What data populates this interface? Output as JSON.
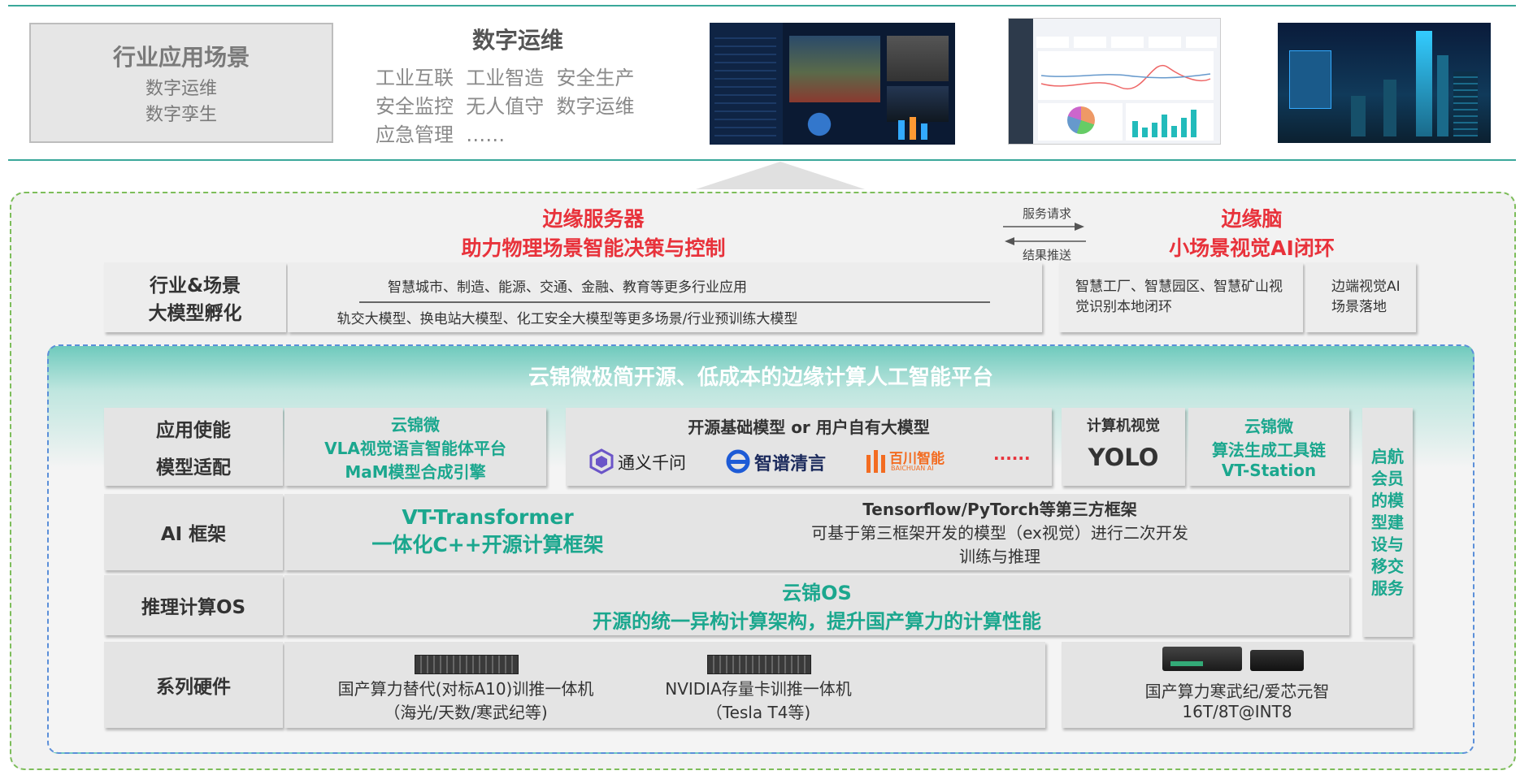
{
  "top": {
    "industry_box": {
      "title": "行业应用场景",
      "line1": "数字运维",
      "line2": "数字孪生"
    },
    "ops": {
      "title": "数字运维",
      "rows": [
        "工业互联  工业智造  安全生产",
        "安全监控  无人值守  数字运维",
        "应急管理  ……"
      ]
    }
  },
  "edge_server": {
    "line1": "边缘服务器",
    "line2": "助力物理场景智能决策与控制"
  },
  "arrows": {
    "request": "服务请求",
    "push": "结果推送"
  },
  "edge_brain": {
    "line1": "边缘脑",
    "line2": "小场景视觉AI闭环"
  },
  "incubation": {
    "label_1": "行业&场景",
    "label_2": "大模型孵化",
    "row1": "智慧城市、制造、能源、交通、金融、教育等更多行业应用",
    "row2": "轨交大模型、换电站大模型、化工安全大模型等更多场景/行业预训练大模型",
    "right1": "智慧工厂、智慧园区、智慧矿山视觉识别本地闭环",
    "right2": "边端视觉AI场景落地"
  },
  "platform": {
    "title": "云锦微极简开源、低成本的边缘计算人工智能平台"
  },
  "app_layer": {
    "label_1": "应用使能",
    "label_2": "模型适配",
    "vla": [
      "云锦微",
      "VLA视觉语言智能体平台",
      "MaM模型合成引擎"
    ],
    "models_title": "开源基础模型 or 用户自有大模型",
    "logos": {
      "tongyi": "通义千问",
      "zhipu": "智谱清言",
      "baichuan": "百川智能",
      "baichuan_sub": "BAICHUAN AI",
      "more": "······"
    },
    "cv_title": "计算机视觉",
    "cv_value": "YOLO",
    "vt_station": [
      "云锦微",
      "算法生成工具链",
      "VT-Station"
    ]
  },
  "side_service": [
    "启航",
    "会员",
    "的模",
    "型建",
    "设与",
    "移交",
    "服务"
  ],
  "ai_framework": {
    "label": "AI 框架",
    "vt": [
      "VT-Transformer",
      "一体化C++开源计算框架"
    ],
    "third": [
      "Tensorflow/PyTorch等第三方框架",
      "可基于第三框架开发的模型（ex视觉）进行二次开发",
      "训练与推理"
    ]
  },
  "os_layer": {
    "label": "推理计算OS",
    "title": "云锦OS",
    "desc": "开源的统一异构计算架构，提升国产算力的计算性能"
  },
  "hardware": {
    "label": "系列硬件",
    "item1": [
      "国产算力替代(对标A10)训推一体机",
      "（海光/天数/寒武纪等)"
    ],
    "item2": [
      "NVIDIA存量卡训推一体机",
      "（Tesla T4等)"
    ],
    "item3": [
      "国产算力寒武纪/爱芯元智",
      "16T/8T@INT8"
    ]
  },
  "colors": {
    "teal": "#1ba78e",
    "red": "#e8323b",
    "gray_box": "#e4e4e4",
    "line": "#3aa89a"
  }
}
